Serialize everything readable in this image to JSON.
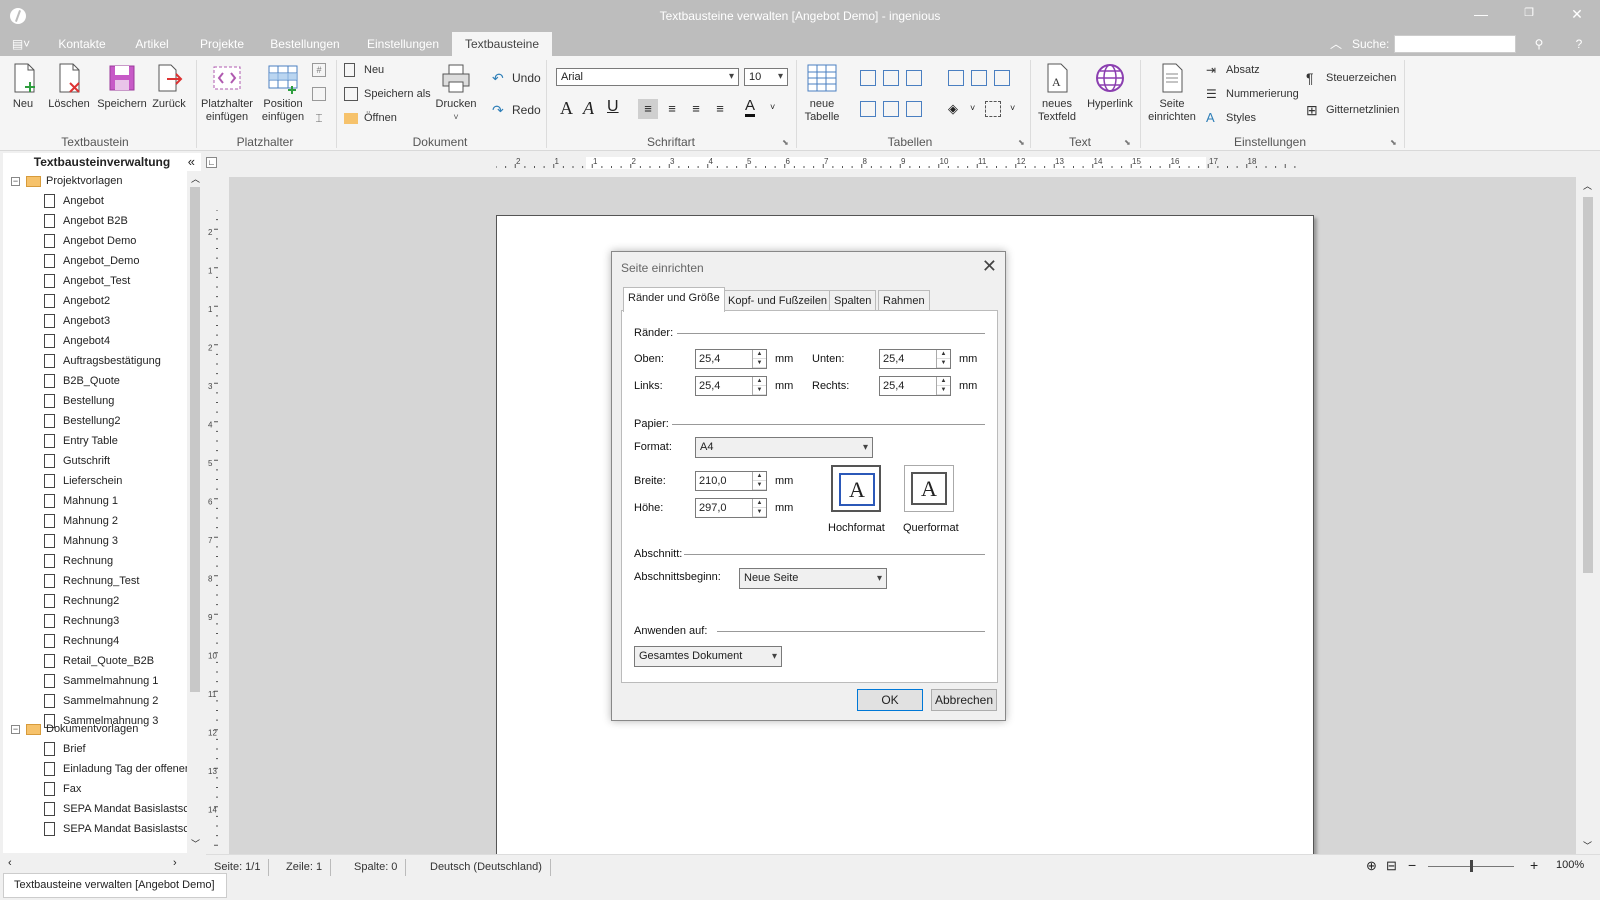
{
  "window": {
    "title": "Textbausteine verwalten [Angebot Demo] - ingenious"
  },
  "menu_tabs": [
    "Kontakte",
    "Artikel",
    "Projekte",
    "Bestellungen",
    "Einstellungen",
    "Textbausteine"
  ],
  "search": {
    "label": "Suche:",
    "value": ""
  },
  "ribbon": {
    "textbaustein": {
      "label": "Textbaustein",
      "neu": "Neu",
      "loeschen": "Löschen",
      "speichern": "Speichern",
      "zurueck": "Zurück"
    },
    "platzhalter": {
      "label": "Platzhalter",
      "platzhalter_einfuegen": "Platzhalter einfügen",
      "position_einfuegen": "Position einfügen"
    },
    "dokument": {
      "label": "Dokument",
      "neu": "Neu",
      "speichern_als": "Speichern als",
      "oeffnen": "Öffnen",
      "drucken": "Drucken",
      "undo": "Undo",
      "redo": "Redo"
    },
    "schriftart": {
      "label": "Schriftart",
      "font": "Arial",
      "size": "10"
    },
    "tabellen": {
      "label": "Tabellen",
      "neue_tabelle": "neue Tabelle"
    },
    "text": {
      "label": "Text",
      "neues_textfeld": "neues Textfeld",
      "hyperlink": "Hyperlink"
    },
    "einstellungen": {
      "label": "Einstellungen",
      "seite_einrichten": "Seite einrichten",
      "absatz": "Absatz",
      "nummerierung": "Nummerierung",
      "styles": "Styles",
      "steuerzeichen": "Steuerzeichen",
      "gitternetzlinien": "Gitternetzlinien"
    }
  },
  "tree": {
    "header": "Textbausteinverwaltung",
    "folder1": "Projektvorlagen",
    "items1": [
      "Angebot",
      "Angebot B2B",
      "Angebot Demo",
      "Angebot_Demo",
      "Angebot_Test",
      "Angebot2",
      "Angebot3",
      "Angebot4",
      "Auftragsbestätigung",
      "B2B_Quote",
      "Bestellung",
      "Bestellung2",
      "Entry Table",
      "Gutschrift",
      "Lieferschein",
      "Mahnung 1",
      "Mahnung 2",
      "Mahnung 3",
      "Rechnung",
      "Rechnung_Test",
      "Rechnung2",
      "Rechnung3",
      "Rechnung4",
      "Retail_Quote_B2B",
      "Sammelmahnung 1",
      "Sammelmahnung 2",
      "Sammelmahnung 3"
    ],
    "folder2": "Dokumentvorlagen",
    "items2": [
      "Brief",
      "Einladung Tag der offener",
      "Fax",
      "SEPA Mandat Basislastsch",
      "SEPA Mandat Basislastsch"
    ]
  },
  "ruler": {
    "h_labels": [
      "2",
      "1",
      "1",
      "2",
      "3",
      "4",
      "5",
      "6",
      "7",
      "8",
      "9",
      "10",
      "11",
      "12",
      "13",
      "14",
      "15",
      "16",
      "17",
      "18"
    ],
    "v_labels": [
      "2",
      "1",
      "1",
      "2",
      "3",
      "4",
      "5",
      "6",
      "7",
      "8",
      "9",
      "10",
      "11",
      "12",
      "13",
      "14"
    ]
  },
  "status": {
    "seite": "Seite: 1/1",
    "zeile": "Zeile: 1",
    "spalte": "Spalte: 0",
    "sprache": "Deutsch (Deutschland)",
    "zoom": "100%",
    "zoom_level": 0.5
  },
  "bottom_tab": "Textbausteine verwalten [Angebot Demo]",
  "dialog": {
    "title": "Seite einrichten",
    "tabs": [
      "Ränder und Größe",
      "Kopf- und Fußzeilen",
      "Spalten",
      "Rahmen"
    ],
    "raender": {
      "label": "Ränder:",
      "oben_label": "Oben:",
      "oben": "25,4",
      "unten_label": "Unten:",
      "unten": "25,4",
      "links_label": "Links:",
      "links": "25,4",
      "rechts_label": "Rechts:",
      "rechts": "25,4",
      "unit": "mm"
    },
    "papier": {
      "label": "Papier:",
      "format_label": "Format:",
      "format": "A4",
      "breite_label": "Breite:",
      "breite": "210,0",
      "hoehe_label": "Höhe:",
      "hoehe": "297,0",
      "unit": "mm",
      "hochformat": "Hochformat",
      "querformat": "Querformat",
      "glyph": "A"
    },
    "abschnitt": {
      "label": "Abschnitt:",
      "beginn_label": "Abschnittsbeginn:",
      "beginn": "Neue Seite"
    },
    "anwenden": {
      "label": "Anwenden auf:",
      "value": "Gesamtes Dokument"
    },
    "ok": "OK",
    "cancel": "Abbrechen"
  }
}
